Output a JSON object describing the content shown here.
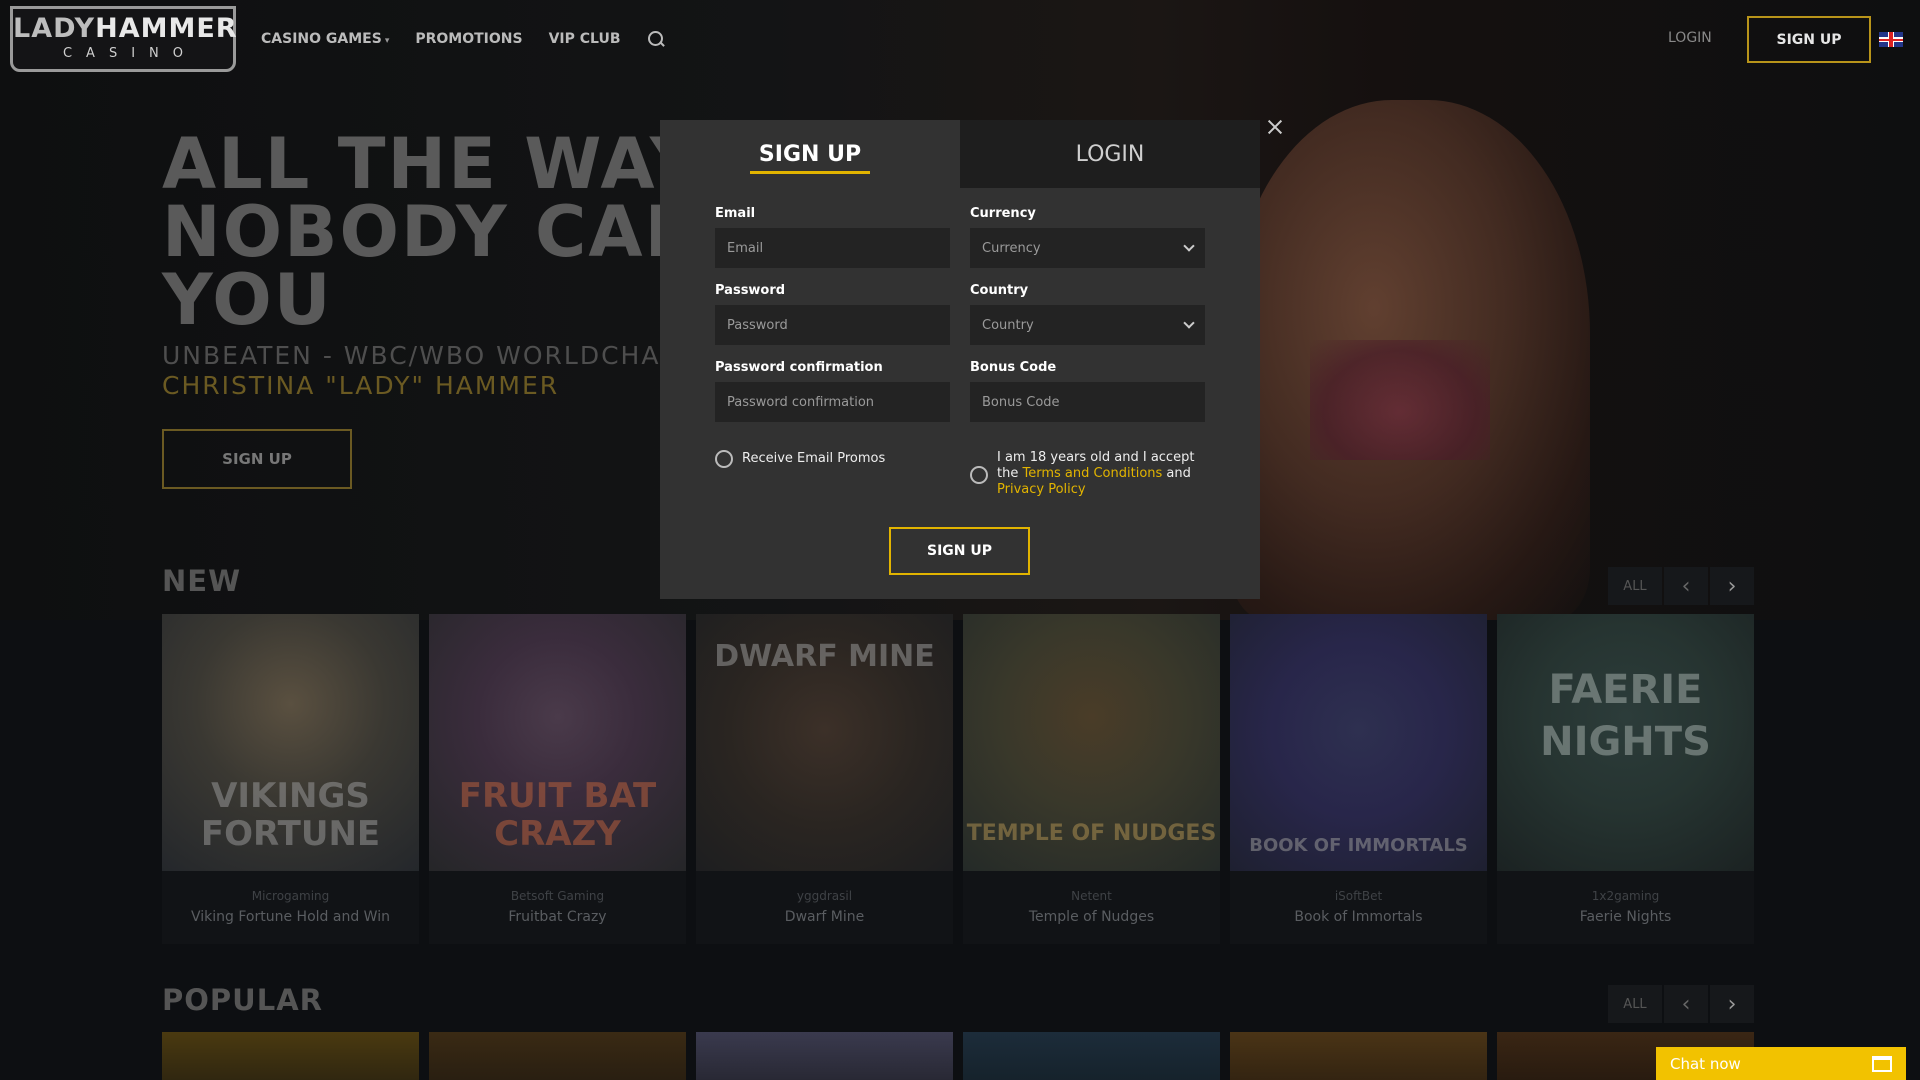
{
  "header": {
    "logo_main_1": "LADY",
    "logo_main_2": "HAMMER",
    "logo_sub": "CASINO",
    "nav": [
      "CASINO GAMES",
      "PROMOTIONS",
      "VIP CLUB"
    ],
    "login": "LOGIN",
    "signup": "SIGN UP",
    "language_icon": "uk-flag-icon"
  },
  "hero": {
    "title_line1": "ALL THE WAY U",
    "title_line2": "NOBODY CAN S",
    "title_line3": "YOU",
    "sub1": "UNBEATEN - WBC/WBO WORLDCHAMPION",
    "sub2": "CHRISTINA \"LADY\" HAMMER",
    "button": "SIGN UP"
  },
  "modal": {
    "tab_signup": "SIGN UP",
    "tab_login": "LOGIN",
    "email_label": "Email",
    "email_placeholder": "Email",
    "currency_label": "Currency",
    "currency_value": "Currency",
    "password_label": "Password",
    "password_placeholder": "Password",
    "country_label": "Country",
    "country_value": "Country",
    "password_conf_label": "Password confirmation",
    "password_conf_placeholder": "Password confirmation",
    "bonus_label": "Bonus Code",
    "bonus_placeholder": "Bonus Code",
    "promos_label": "Receive Email Promos",
    "terms_pre": "I am 18 years old and I accept the ",
    "terms_link": "Terms and Conditions",
    "terms_mid": " and ",
    "privacy_link": "Privacy Policy",
    "submit": "SIGN UP"
  },
  "sections": {
    "new_title": "NEW",
    "popular_title": "POPULAR",
    "all_label": "ALL"
  },
  "new_games": [
    {
      "provider": "Microgaming",
      "name": "Viking Fortune Hold and Win",
      "art": "VIKINGS FORTUNE"
    },
    {
      "provider": "Betsoft Gaming",
      "name": "Fruitbat Crazy",
      "art": "FRUIT BAT CRAZY"
    },
    {
      "provider": "yggdrasil",
      "name": "Dwarf Mine",
      "art": "DWARF MINE"
    },
    {
      "provider": "Netent",
      "name": "Temple of Nudges",
      "art": "TEMPLE OF NUDGES"
    },
    {
      "provider": "iSoftBet",
      "name": "Book of Immortals",
      "art": "BOOK OF IMMORTALS"
    },
    {
      "provider": "1x2gaming",
      "name": "Faerie Nights",
      "art": "FAERIE NIGHTS"
    }
  ],
  "chat": {
    "label": "Chat now"
  },
  "colors": {
    "accent": "#e2b400",
    "modal_bg": "#323232",
    "page_bg": "#0d0f12"
  }
}
